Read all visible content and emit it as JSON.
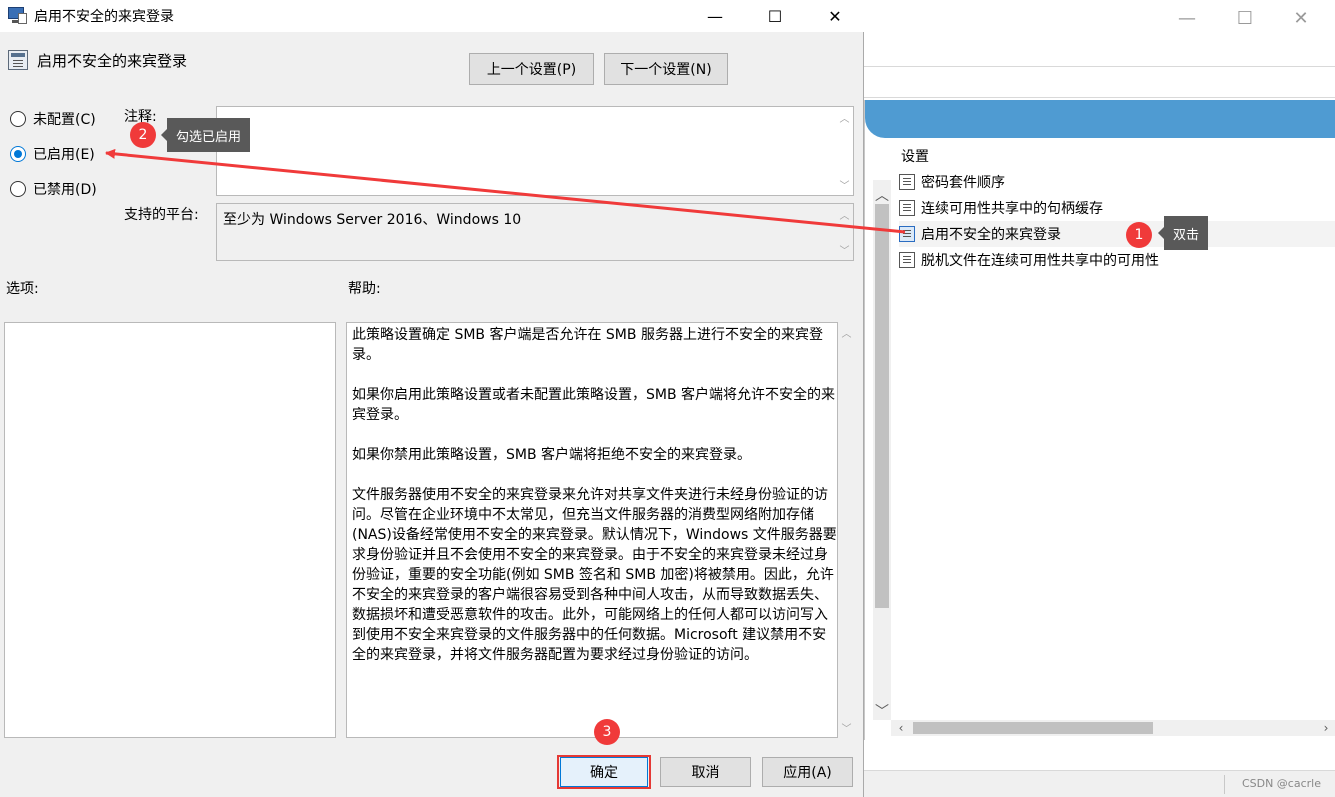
{
  "dialog": {
    "window_title": "启用不安全的来宾登录",
    "header_title": "启用不安全的来宾登录",
    "prev_button": "上一个设置(P)",
    "next_button": "下一个设置(N)",
    "radio_options": [
      {
        "label": "未配置(C)",
        "selected": false
      },
      {
        "label": "已启用(E)",
        "selected": true
      },
      {
        "label": "已禁用(D)",
        "selected": false
      }
    ],
    "comment_label": "注释:",
    "comment_value": "",
    "platform_label": "支持的平台:",
    "platform_value": "至少为 Windows Server 2016、Windows 10",
    "options_label": "选项:",
    "help_label": "帮助:",
    "help_paragraphs": [
      "此策略设置确定 SMB 客户端是否允许在 SMB 服务器上进行不安全的来宾登录。",
      "如果你启用此策略设置或者未配置此策略设置，SMB 客户端将允许不安全的来宾登录。",
      "如果你禁用此策略设置，SMB 客户端将拒绝不安全的来宾登录。",
      "文件服务器使用不安全的来宾登录来允许对共享文件夹进行未经身份验证的访问。尽管在企业环境中不太常见，但充当文件服务器的消费型网络附加存储(NAS)设备经常使用不安全的来宾登录。默认情况下，Windows 文件服务器要求身份验证并且不会使用不安全的来宾登录。由于不安全的来宾登录未经过身份验证，重要的安全功能(例如 SMB 签名和 SMB 加密)将被禁用。因此，允许不安全的来宾登录的客户端很容易受到各种中间人攻击，从而导致数据丢失、数据损坏和遭受恶意软件的攻击。此外，可能网络上的任何人都可以访问写入到使用不安全来宾登录的文件服务器中的任何数据。Microsoft 建议禁用不安全的来宾登录，并将文件服务器配置为要求经过身份验证的访问。"
    ],
    "ok_button": "确定",
    "cancel_button": "取消",
    "apply_button": "应用(A)"
  },
  "background_window": {
    "settings_header": "设置",
    "items": [
      {
        "label": "密码套件顺序",
        "selected": false
      },
      {
        "label": "连续可用性共享中的句柄缓存",
        "selected": false
      },
      {
        "label": "启用不安全的来宾登录",
        "selected": true
      },
      {
        "label": "脱机文件在连续可用性共享中的可用性",
        "selected": false
      }
    ],
    "watermark": "CSDN @cacrle"
  },
  "annotations": {
    "step1_number": "1",
    "step1_text": "双击",
    "step2_number": "2",
    "step2_text": "勾选已启用",
    "step3_number": "3",
    "color": "#f03a3a"
  }
}
